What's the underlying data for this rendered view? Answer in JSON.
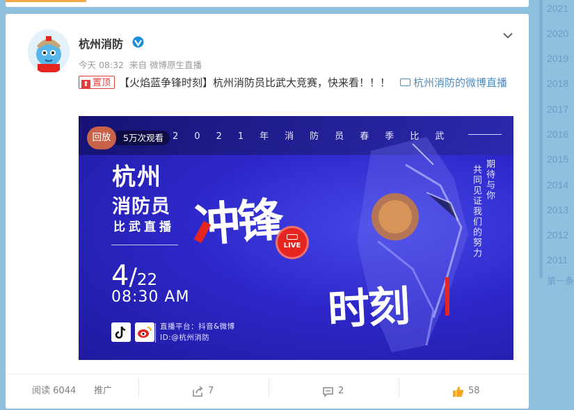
{
  "post": {
    "author": "杭州消防",
    "meta_time": "今天 08:32",
    "meta_source": "来自 微博原生直播",
    "pin_label": "置顶",
    "hashtag": "【火焰蓝争锋时刻】",
    "body": "杭州消防员比武大竞赛，快来看！！！",
    "live_link": "杭州消防的微博直播"
  },
  "poster": {
    "replay_label": "回放",
    "view_count": "5万次观看",
    "tagline_chars": [
      "2",
      "0",
      "2",
      "1",
      "年",
      "消",
      "防",
      "员",
      "春",
      "季",
      "比",
      "武"
    ],
    "title_city": "杭州",
    "title_role": "消防员",
    "title_event": "比武直播",
    "date_month": "4",
    "date_slash": "/",
    "date_day": "22",
    "time": "08:30 AM",
    "platform_line": "直播平台：抖音&微博",
    "id_line": "ID:@杭州消防",
    "big_text_1": "冲锋",
    "big_text_2": "时刻",
    "live_label": "LIVE",
    "vertical_1": "期待与你",
    "vertical_2": "共同见证我们的努力"
  },
  "actions": {
    "read_label": "阅读",
    "read_count": "6044",
    "promote_label": "推广",
    "share_count": "7",
    "comment_count": "2",
    "like_count": "58"
  },
  "timeline": {
    "years": [
      "2021",
      "2020",
      "2019",
      "2018",
      "2017",
      "2016",
      "2015",
      "2014",
      "2013",
      "2012",
      "2011"
    ],
    "more_label": "第一条"
  },
  "colors": {
    "page_bg": "#8fc1df",
    "link": "#4a8cc4",
    "pin_red": "#e23c3c",
    "poster_blue": "#2d27c9",
    "live_red": "#e5251f",
    "verified_blue": "#1a8fdc",
    "like_orange": "#f5a623"
  }
}
